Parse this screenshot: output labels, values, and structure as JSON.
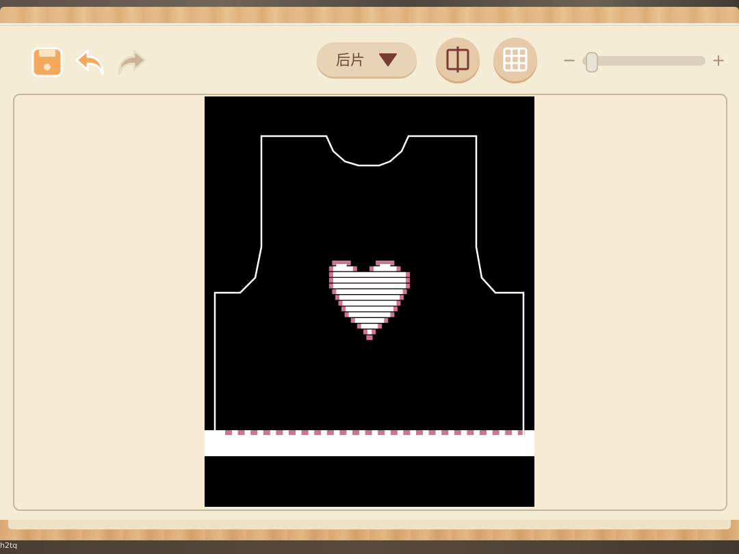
{
  "toolbar": {
    "save_icon": "save-icon",
    "undo_icon": "undo-arrow-icon",
    "redo_icon": "redo-arrow-icon",
    "piece_select": {
      "label": "后片",
      "icon": "triangle-down-icon"
    },
    "mirror_icon": "mirror-split-icon",
    "grid_icon": "grid-icon",
    "zoom": {
      "minus": "−",
      "plus": "+",
      "level": 0.03
    }
  },
  "corner_text": "h2tq",
  "colors": {
    "accent_orange": "#f4a95c",
    "piece_button": "#e8d3b6",
    "paper": "#f5ecd6",
    "canvas_bg": "#000000",
    "outline": "#ffffff",
    "heart_fill": "#ffffff",
    "heart_border": "#d07393",
    "hem_band": "#ffffff",
    "hem_dots": "#d07393"
  }
}
